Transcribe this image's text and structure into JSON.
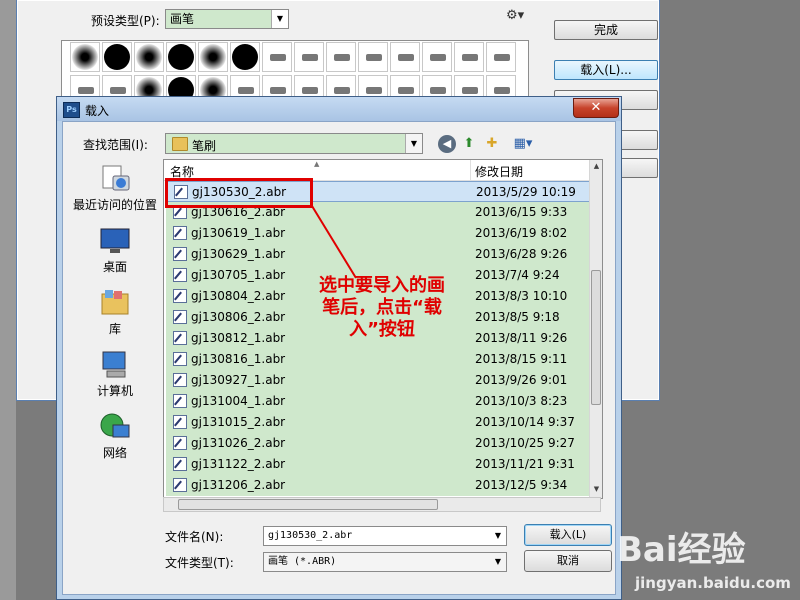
{
  "preset_manager": {
    "preset_type_label": "预设类型(P):",
    "preset_type_value": "画笔",
    "buttons": {
      "done": "完成",
      "load": "载入(L)..."
    }
  },
  "dialog": {
    "title": "载入",
    "look_in_label": "查找范围(I):",
    "look_in_value": "笔刷",
    "places": [
      {
        "label": "最近访问的位置",
        "icon": "recent-places-icon"
      },
      {
        "label": "桌面",
        "icon": "desktop-icon"
      },
      {
        "label": "库",
        "icon": "libraries-icon"
      },
      {
        "label": "计算机",
        "icon": "computer-icon"
      },
      {
        "label": "网络",
        "icon": "network-icon"
      }
    ],
    "columns": {
      "name": "名称",
      "date": "修改日期"
    },
    "files": [
      {
        "name": "gj130530_2.abr",
        "date": "2013/5/29 10:19",
        "selected": true
      },
      {
        "name": "gj130616_2.abr",
        "date": "2013/6/15 9:33"
      },
      {
        "name": "gj130619_1.abr",
        "date": "2013/6/19 8:02"
      },
      {
        "name": "gj130629_1.abr",
        "date": "2013/6/28 9:26"
      },
      {
        "name": "gj130705_1.abr",
        "date": "2013/7/4 9:24"
      },
      {
        "name": "gj130804_2.abr",
        "date": "2013/8/3 10:10"
      },
      {
        "name": "gj130806_2.abr",
        "date": "2013/8/5 9:18"
      },
      {
        "name": "gj130812_1.abr",
        "date": "2013/8/11 9:26"
      },
      {
        "name": "gj130816_1.abr",
        "date": "2013/8/15 9:11"
      },
      {
        "name": "gj130927_1.abr",
        "date": "2013/9/26 9:01"
      },
      {
        "name": "gj131004_1.abr",
        "date": "2013/10/3 8:23"
      },
      {
        "name": "gj131015_2.abr",
        "date": "2013/10/14 9:37"
      },
      {
        "name": "gj131026_2.abr",
        "date": "2013/10/25 9:27"
      },
      {
        "name": "gj131122_2.abr",
        "date": "2013/11/21 9:31"
      },
      {
        "name": "gj131206_2.abr",
        "date": "2013/12/5 9:34"
      }
    ],
    "file_name_label": "文件名(N):",
    "file_name_value": "gj130530_2.abr",
    "file_type_label": "文件类型(T):",
    "file_type_value": "画笔 (*.ABR)",
    "load_button": "载入(L)",
    "cancel_button": "取消"
  },
  "annotation": {
    "text_line1": "选中要导入的画",
    "text_line2": "笔后，点击“载",
    "text_line3": "入”按钮",
    "color": "#e00000"
  },
  "watermark": {
    "logo": "Bai经验",
    "url": "jingyan.baidu.com"
  }
}
